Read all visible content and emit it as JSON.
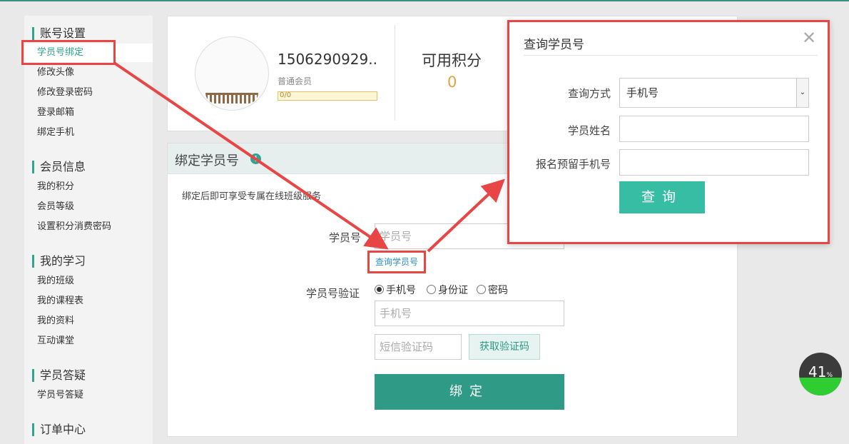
{
  "sidebar": {
    "sections": [
      {
        "title": "账号设置",
        "items": [
          "学员号绑定",
          "修改头像",
          "修改登录密码",
          "登录邮箱",
          "绑定手机"
        ]
      },
      {
        "title": "会员信息",
        "items": [
          "我的积分",
          "会员等级",
          "设置积分消费密码"
        ]
      },
      {
        "title": "我的学习",
        "items": [
          "我的班级",
          "我的课程表",
          "我的资料",
          "互动课堂"
        ]
      },
      {
        "title": "学员答疑",
        "items": [
          "学员号答疑"
        ]
      },
      {
        "title": "订单中心",
        "items": []
      }
    ]
  },
  "profile": {
    "username": "1506290929..",
    "level": "普通会员",
    "level_progress": "0/0",
    "points_label": "可用积分",
    "points_value": "0"
  },
  "bind": {
    "title": "绑定学员号",
    "info_icon": "info-icon",
    "tip": "绑定后即可享受专属在线班级服务",
    "student_id_label": "学员号",
    "student_id_placeholder": "学员号",
    "query_link": "查询学员号",
    "verify_label": "学员号验证",
    "verify_options": [
      "手机号",
      "身份证",
      "密码"
    ],
    "verify_selected": "手机号",
    "phone_placeholder": "手机号",
    "sms_placeholder": "短信验证码",
    "sms_button": "获取验证码",
    "submit": "绑定"
  },
  "modal": {
    "title": "查询学员号",
    "close_icon": "close-icon",
    "method_label": "查询方式",
    "method_value": "手机号",
    "name_label": "学员姓名",
    "phone_label": "报名预留手机号",
    "query_button": "查询"
  },
  "progress_widget": {
    "value": 41,
    "unit": "%"
  },
  "colors": {
    "accent": "#2fa58e",
    "highlight": "#e84545",
    "points": "#e6a23c"
  }
}
